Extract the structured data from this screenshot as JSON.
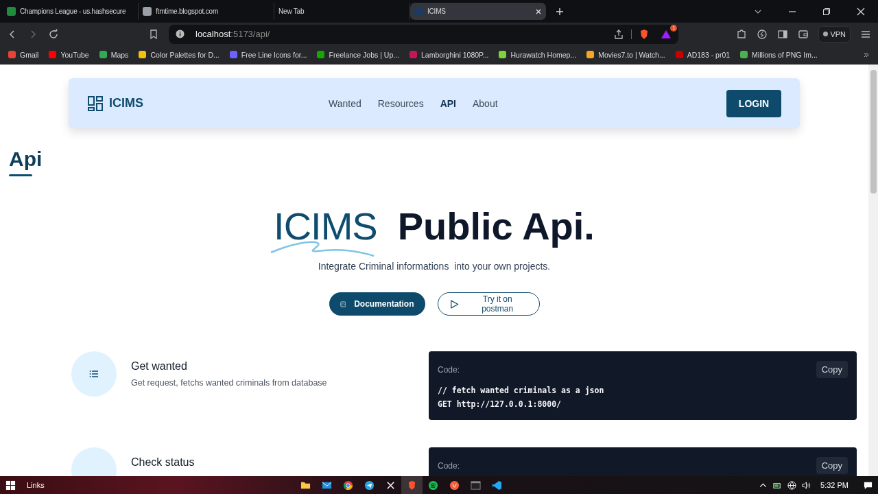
{
  "browser": {
    "tabs": [
      {
        "title": "Champions League - us.hashsecure",
        "color": "#1e8e3e",
        "selected": false
      },
      {
        "title": "ftmtime.blogspot.com",
        "color": "#9aa0a6",
        "selected": false
      },
      {
        "title": "New Tab",
        "selected": false
      },
      {
        "title": "ICIMS",
        "color": "#1e3a5f",
        "selected": true
      }
    ],
    "address": {
      "host": "localhost",
      "path": ":5173/api/"
    },
    "extension_badge": "1",
    "vpn": "VPN",
    "bookmarks": [
      {
        "title": "Gmail",
        "color": "#ea4335"
      },
      {
        "title": "YouTube",
        "color": "#ff0000"
      },
      {
        "title": "Maps",
        "color": "#34a853"
      },
      {
        "title": "Color Palettes for D...",
        "color": "#f4c20d"
      },
      {
        "title": "Free Line Icons for...",
        "color": "#6c63ff"
      },
      {
        "title": "Freelance Jobs | Up...",
        "color": "#14a800"
      },
      {
        "title": "Lamborghini 1080P...",
        "color": "#c2185b"
      },
      {
        "title": "Hurawatch Homep...",
        "color": "#7cd33b"
      },
      {
        "title": "Movies7.to | Watch...",
        "color": "#f5a623"
      },
      {
        "title": "AD183 - pr01",
        "color": "#cc0000"
      },
      {
        "title": "Millions of PNG Im...",
        "color": "#4caf50"
      }
    ]
  },
  "navbar": {
    "brand": "ICIMS",
    "links": [
      {
        "label": "Wanted",
        "selected": false
      },
      {
        "label": "Resources",
        "selected": false
      },
      {
        "label": "API",
        "selected": true
      },
      {
        "label": "About",
        "selected": false
      }
    ],
    "login": "LOGIN"
  },
  "page_title": "Api",
  "hero": {
    "brand": "ICIMS",
    "title": "Public Api.",
    "subtitle": "Integrate Criminal informations  into your own projects.",
    "primary_button": "Documentation",
    "secondary_button": "Try it on postman"
  },
  "endpoints": [
    {
      "title": "Get wanted",
      "description": "Get request, fetchs wanted criminals from database",
      "code_label": "Code:",
      "copy": "Copy",
      "code": [
        "// fetch wanted criminals as a json",
        "GET http://127.0.0.1:8000/"
      ]
    },
    {
      "title": "Check status",
      "code_label": "Code:",
      "copy": "Copy"
    }
  ],
  "taskbar": {
    "toolbar": "Links",
    "time": "5:32 PM"
  }
}
